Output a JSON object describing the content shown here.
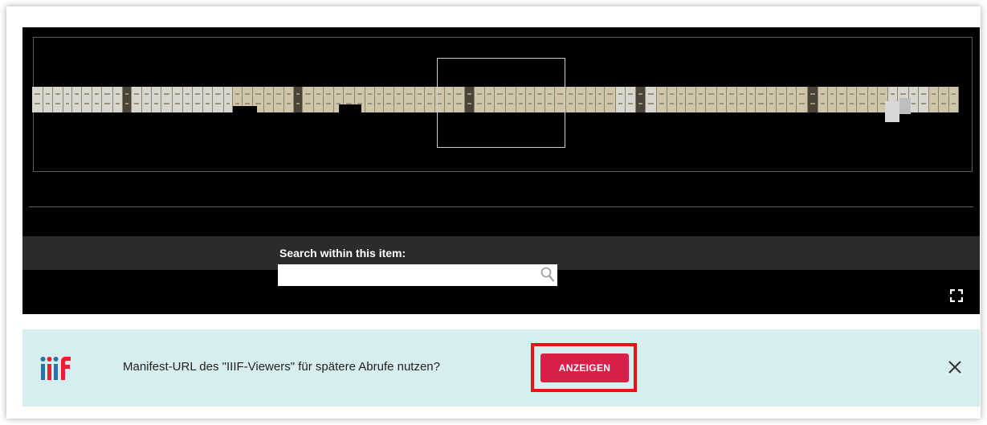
{
  "viewer": {
    "search_label": "Search within this item:",
    "search_value": "",
    "search_placeholder": ""
  },
  "banner": {
    "logo_text": "iiif",
    "message": "Manifest-URL des \"IIIF-Viewers\" für spätere Abrufe nutzen?",
    "button_label": "ANZEIGEN",
    "button_color": "#d81f48",
    "background_color": "#d7eeee",
    "highlight_color": "#ee1111"
  },
  "icons": {
    "search": "search-icon",
    "fullscreen": "fullscreen-icon",
    "close": "close-icon",
    "logo": "iiif-logo-icon"
  }
}
